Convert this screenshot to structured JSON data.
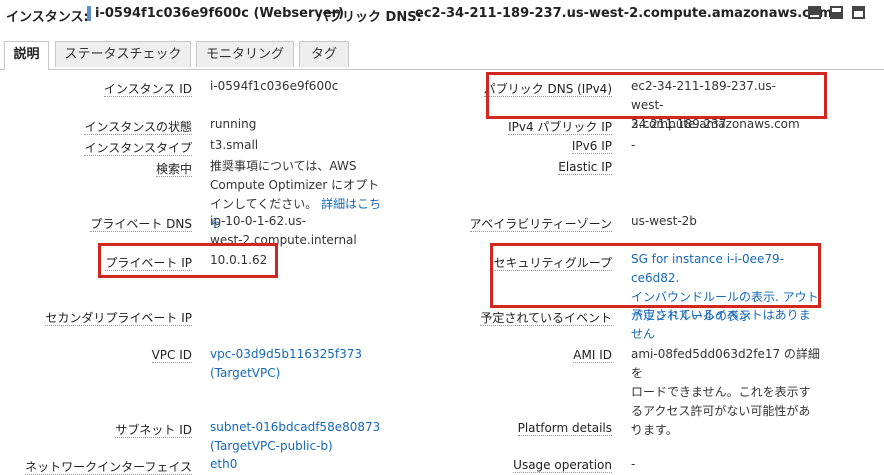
{
  "header": {
    "instance_label": "インスタンス:",
    "instance_id": "i-0594f1c036e9f600c (Webserver)",
    "dns_label": "パブリック DNS:",
    "dns_value": "ec2-34-211-189-237.us-west-2.compute.amazonaws.com"
  },
  "tabs": [
    "説明",
    "ステータスチェック",
    "モニタリング",
    "タグ"
  ],
  "left": {
    "instance_id_label": "インスタンス ID",
    "instance_id": "i-0594f1c036e9f600c",
    "state_label": "インスタンスの状態",
    "state": "running",
    "type_label": "インスタンスタイプ",
    "type": "t3.small",
    "finding_label": "検索中",
    "finding_text": "推奨事項については、AWS Compute Optimizer にオプトインしてください。",
    "finding_link": "詳細はこちら",
    "private_dns_label": "プライベート DNS",
    "private_dns_1": "ip-10-0-1-62.us-",
    "private_dns_2": "west-2.compute.internal",
    "private_ip_label": "プライベート IP",
    "private_ip": "10.0.1.62",
    "secondary_ip_label": "セカンダリプライベート IP",
    "vpc_label": "VPC ID",
    "vpc_1": "vpc-03d9d5b116325f373",
    "vpc_2": "(TargetVPC)",
    "subnet_label": "サブネット ID",
    "subnet_1": "subnet-016bdcadf58e80873",
    "subnet_2": "(TargetVPC-public-b)",
    "nic_label": "ネットワークインターフェイス",
    "nic": "eth0"
  },
  "right": {
    "public_dns_label": "パブリック DNS (IPv4)",
    "public_dns_1": "ec2-34-211-189-237.us-",
    "public_dns_2": "west-2.compute.amazonaws.com",
    "ipv4_label": "IPv4 パブリック IP",
    "ipv4": "34.211.189.237",
    "ipv6_label": "IPv6 IP",
    "ipv6": "-",
    "elastic_label": "Elastic IP",
    "az_label": "アベイラビリティーゾーン",
    "az": "us-west-2b",
    "sg_label": "セキュリティグループ",
    "sg_1": "SG for instance i-i-0ee79-ce6d82.",
    "sg_2": "インバウンドルールの表示. アウト",
    "sg_3": "バウンドルールの表示",
    "events_label": "予定されているイベント",
    "events_1": "予定されているイベントはありま",
    "events_2": "せん",
    "ami_label": "AMI ID",
    "ami_1": "ami-08fed5dd063d2fe17 の詳細を",
    "ami_2": "ロードできません。これを表示す",
    "ami_3": "るアクセス許可がない可能性があ",
    "ami_4": "ります。",
    "platform_label": "Platform details",
    "platform": "-",
    "usage_label": "Usage operation",
    "usage": "-"
  },
  "colors": {
    "highlight": "#d0281f",
    "link": "#1668b6",
    "id_bar": "#5b8fc7"
  }
}
